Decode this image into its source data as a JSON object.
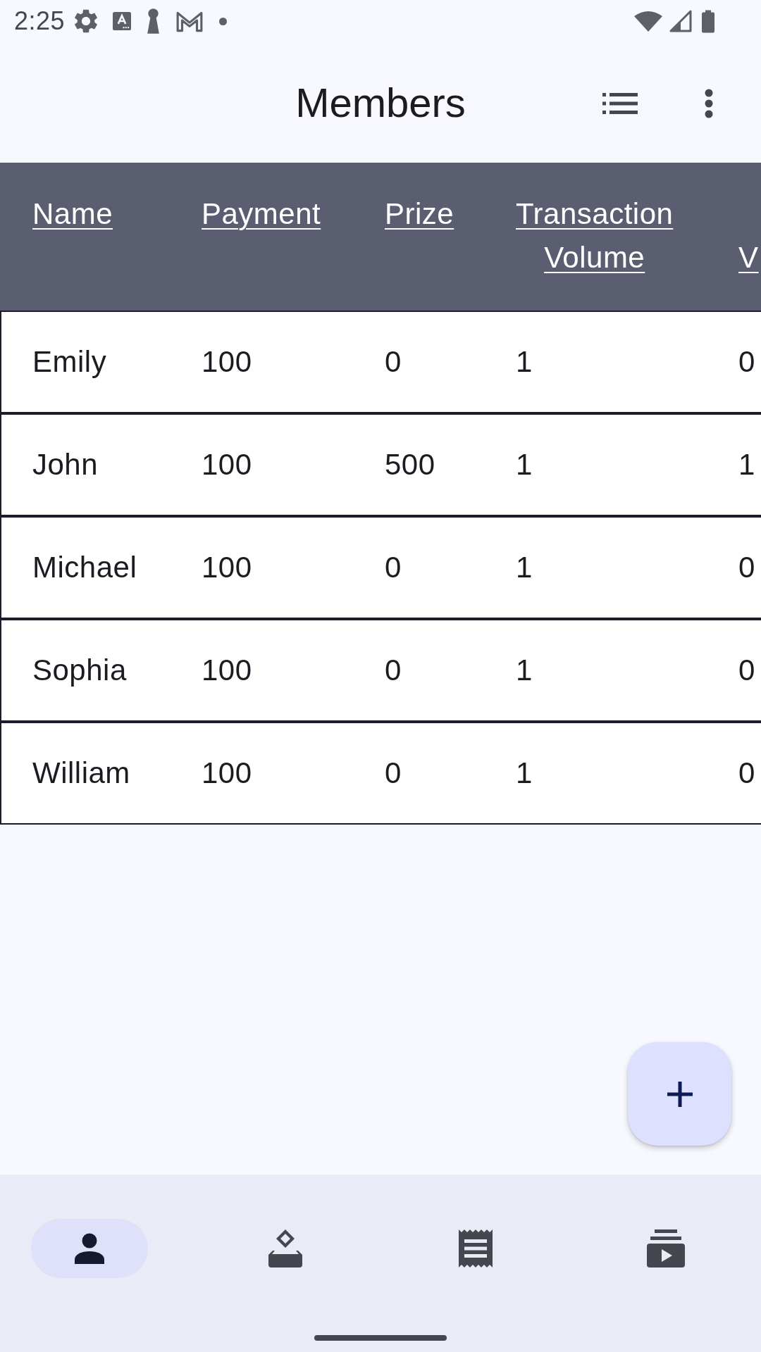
{
  "status_bar": {
    "time": "2:25"
  },
  "app_bar": {
    "title": "Members"
  },
  "table": {
    "columns": [
      {
        "label": "Name",
        "kind": "full"
      },
      {
        "label": "Payment",
        "kind": "full"
      },
      {
        "label": "Prize",
        "kind": "full"
      },
      {
        "label": "Transaction Volume",
        "kind": "full"
      },
      {
        "label": "V",
        "kind": "cut_off"
      }
    ],
    "rows": [
      {
        "cells": [
          "Emily",
          "100",
          "0",
          "1",
          "0"
        ]
      },
      {
        "cells": [
          "John",
          "100",
          "500",
          "1",
          "1"
        ]
      },
      {
        "cells": [
          "Michael",
          "100",
          "0",
          "1",
          "0"
        ]
      },
      {
        "cells": [
          "Sophia",
          "100",
          "0",
          "1",
          "0"
        ]
      },
      {
        "cells": [
          "William",
          "100",
          "0",
          "1",
          "0"
        ]
      }
    ]
  },
  "bottom_nav": {
    "items": [
      {
        "selected": true
      },
      {
        "selected": false
      },
      {
        "selected": false
      },
      {
        "selected": false
      }
    ]
  }
}
